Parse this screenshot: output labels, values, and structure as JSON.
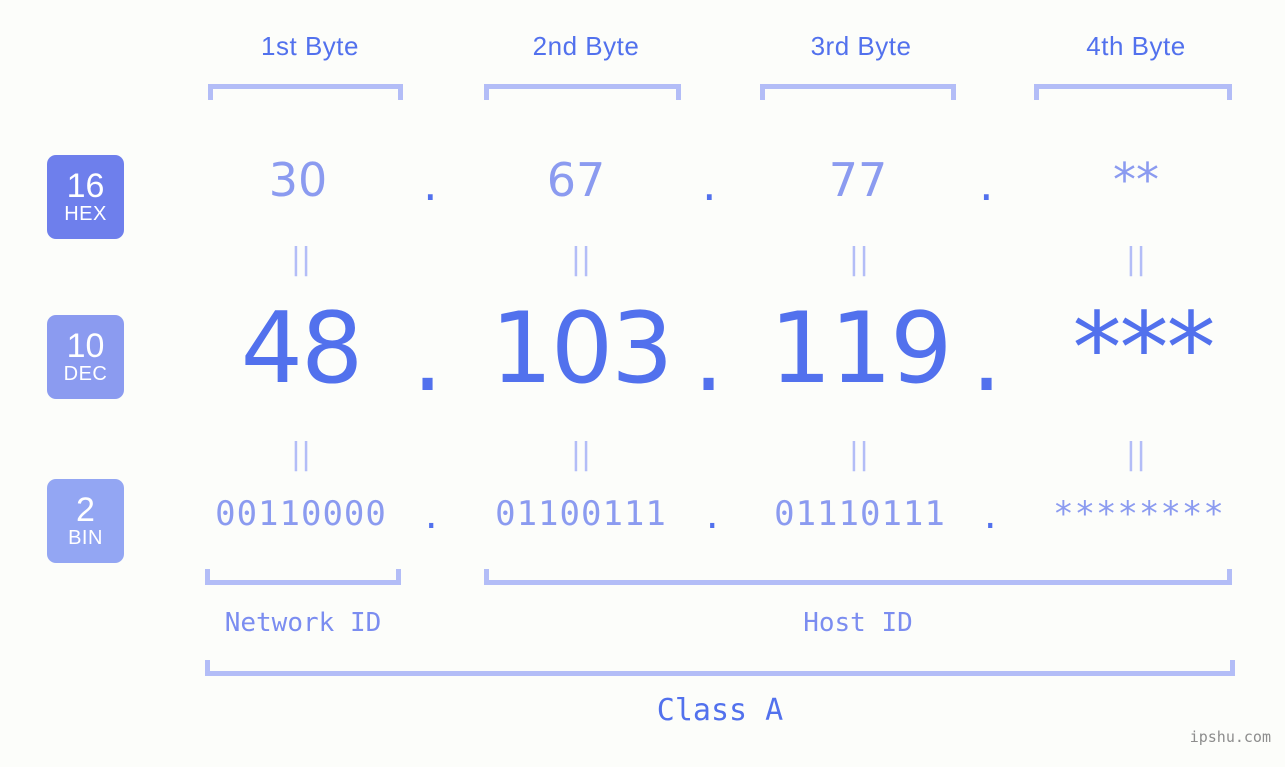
{
  "headers": [
    {
      "label": "1st Byte"
    },
    {
      "label": "2nd Byte"
    },
    {
      "label": "3rd Byte"
    },
    {
      "label": "4th Byte"
    }
  ],
  "bases": [
    {
      "num": "16",
      "abbr": "HEX",
      "color": "#6e7fec"
    },
    {
      "num": "10",
      "abbr": "DEC",
      "color": "#8b9bf0"
    },
    {
      "num": "2",
      "abbr": "BIN",
      "color": "#93a6f3"
    }
  ],
  "rows": {
    "hex": {
      "values": [
        "30",
        "67",
        "77",
        "**"
      ],
      "separator": "."
    },
    "dec": {
      "values": [
        "48",
        "103",
        "119",
        "***"
      ],
      "separator": "."
    },
    "bin": {
      "values": [
        "00110000",
        "01100111",
        "01110111",
        "********"
      ],
      "separator": "."
    }
  },
  "equals_marker": "||",
  "segments": {
    "network_id": "Network ID",
    "host_id": "Host ID"
  },
  "class_label": "Class A",
  "watermark": "ipshu.com",
  "colors": {
    "background": "#fcfdfa",
    "accent_strong": "#5271ed",
    "accent_mid": "#8b9bf0",
    "accent_light": "#b3bdf7",
    "watermark": "#8d8d8d"
  }
}
